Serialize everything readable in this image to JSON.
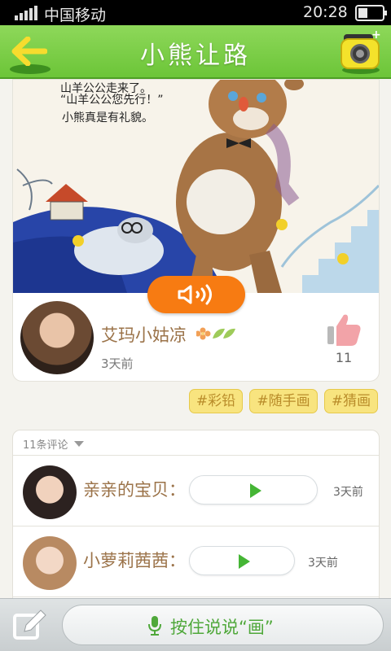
{
  "status_bar": {
    "carrier": "中国移动",
    "time": "20:28"
  },
  "header": {
    "title": "小熊让路",
    "back_icon": "back-arrow-icon",
    "camera_icon": "camera-icon"
  },
  "post": {
    "artwork_lines": [
      "山羊公公走来了。",
      "“山羊公公您先行！”",
      "小熊真是有礼貌。"
    ],
    "audio_icon": "speaker-icon",
    "author": {
      "name": "艾玛小姑凉",
      "time": "3天前",
      "badge_icons": "flower-leaf-icons"
    },
    "likes": "11",
    "like_icon": "thumbs-up-icon"
  },
  "tags": [
    "#彩铅",
    "#随手画",
    "#猜画"
  ],
  "comments": {
    "count_label": "11条评论",
    "items": [
      {
        "name": "亲亲的宝贝：",
        "time": "3天前"
      },
      {
        "name": "小萝莉茜茜：",
        "time": "3天前"
      }
    ]
  },
  "bottom_bar": {
    "edit_icon": "edit-icon",
    "mic_icon": "microphone-icon",
    "voice_label": "按住说说“画”"
  },
  "colors": {
    "header_green": "#6cc538",
    "accent_orange": "#f77b12",
    "tag_yellow": "#f8e47f",
    "name_brown": "#9b7349",
    "play_green": "#45b535"
  }
}
